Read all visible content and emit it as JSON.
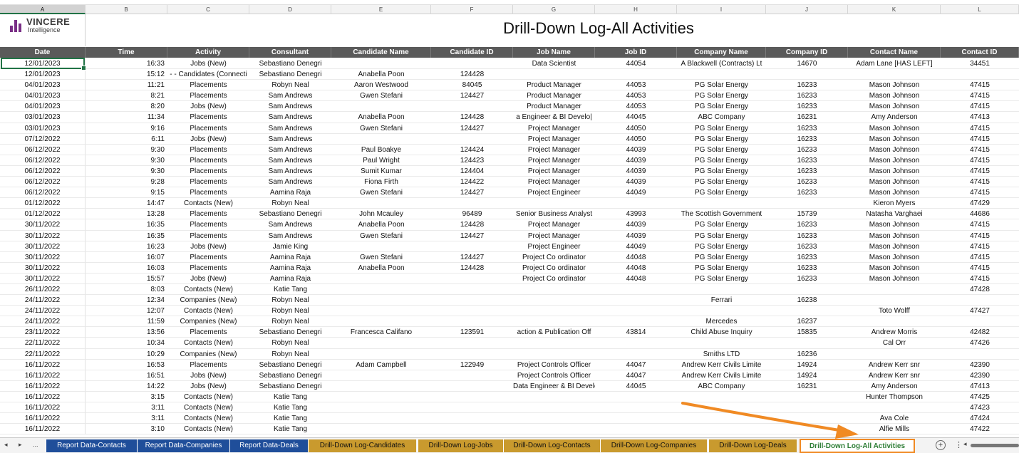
{
  "title": "Drill-Down Log-All Activities",
  "logo": {
    "name": "VINCERE",
    "sub": "Intelligence"
  },
  "column_letters": [
    "A",
    "B",
    "C",
    "D",
    "E",
    "F",
    "G",
    "H",
    "I",
    "J",
    "K",
    "L"
  ],
  "headers": [
    "Date",
    "Time",
    "Activity",
    "Consultant",
    "Candidate Name",
    "Candidate ID",
    "Job Name",
    "Job ID",
    "Company Name",
    "Company ID",
    "Contact Name",
    "Contact ID"
  ],
  "rows": [
    [
      "12/01/2023",
      "16:33",
      "Jobs (New)",
      "Sebastiano Denegri",
      "",
      "",
      "Data Scientist",
      "44054",
      "A Blackwell (Contracts) Lt",
      "14670",
      "Adam Lane [HAS LEFT]",
      "34451"
    ],
    [
      "12/01/2023",
      "15:12",
      "- - Candidates (Connecti",
      "Sebastiano Denegri",
      "Anabella Poon",
      "124428",
      "",
      "",
      "",
      "",
      "",
      ""
    ],
    [
      "04/01/2023",
      "11:21",
      "Placements",
      "Robyn Neal",
      "Aaron Westwood",
      "84045",
      "Product Manager",
      "44053",
      "PG Solar Energy",
      "16233",
      "Mason Johnson",
      "47415"
    ],
    [
      "04/01/2023",
      "8:21",
      "Placements",
      "Sam Andrews",
      "Gwen Stefani",
      "124427",
      "Product Manager",
      "44053",
      "PG Solar Energy",
      "16233",
      "Mason Johnson",
      "47415"
    ],
    [
      "04/01/2023",
      "8:20",
      "Jobs (New)",
      "Sam Andrews",
      "",
      "",
      "Product Manager",
      "44053",
      "PG Solar Energy",
      "16233",
      "Mason Johnson",
      "47415"
    ],
    [
      "03/01/2023",
      "11:34",
      "Placements",
      "Sam Andrews",
      "Anabella Poon",
      "124428",
      "a Engineer & BI Develo|",
      "44045",
      "ABC Company",
      "16231",
      "Amy Anderson",
      "47413"
    ],
    [
      "03/01/2023",
      "9:16",
      "Placements",
      "Sam Andrews",
      "Gwen Stefani",
      "124427",
      "Project Manager",
      "44050",
      "PG Solar Energy",
      "16233",
      "Mason Johnson",
      "47415"
    ],
    [
      "07/12/2022",
      "6:11",
      "Jobs (New)",
      "Sam Andrews",
      "",
      "",
      "Project Manager",
      "44050",
      "PG Solar Energy",
      "16233",
      "Mason Johnson",
      "47415"
    ],
    [
      "06/12/2022",
      "9:30",
      "Placements",
      "Sam Andrews",
      "Paul Boakye",
      "124424",
      "Project Manager",
      "44039",
      "PG Solar Energy",
      "16233",
      "Mason Johnson",
      "47415"
    ],
    [
      "06/12/2022",
      "9:30",
      "Placements",
      "Sam Andrews",
      "Paul Wright",
      "124423",
      "Project Manager",
      "44039",
      "PG Solar Energy",
      "16233",
      "Mason Johnson",
      "47415"
    ],
    [
      "06/12/2022",
      "9:30",
      "Placements",
      "Sam Andrews",
      "Sumit Kumar",
      "124404",
      "Project Manager",
      "44039",
      "PG Solar Energy",
      "16233",
      "Mason Johnson",
      "47415"
    ],
    [
      "06/12/2022",
      "9:28",
      "Placements",
      "Sam Andrews",
      "Fiona Firth",
      "124422",
      "Project Manager",
      "44039",
      "PG Solar Energy",
      "16233",
      "Mason Johnson",
      "47415"
    ],
    [
      "06/12/2022",
      "9:15",
      "Placements",
      "Aamina Raja",
      "Gwen Stefani",
      "124427",
      "Project Engineer",
      "44049",
      "PG Solar Energy",
      "16233",
      "Mason Johnson",
      "47415"
    ],
    [
      "01/12/2022",
      "14:47",
      "Contacts (New)",
      "Robyn Neal",
      "",
      "",
      "",
      "",
      "",
      "",
      "Kieron Myers",
      "47429"
    ],
    [
      "01/12/2022",
      "13:28",
      "Placements",
      "Sebastiano Denegri",
      "John Mcauley",
      "96489",
      "Senior Business Analyst",
      "43993",
      "The Scottish Government",
      "15739",
      "Natasha Varghaei",
      "44686"
    ],
    [
      "30/11/2022",
      "16:35",
      "Placements",
      "Sam Andrews",
      "Anabella Poon",
      "124428",
      "Project Manager",
      "44039",
      "PG Solar Energy",
      "16233",
      "Mason Johnson",
      "47415"
    ],
    [
      "30/11/2022",
      "16:35",
      "Placements",
      "Sam Andrews",
      "Gwen Stefani",
      "124427",
      "Project Manager",
      "44039",
      "PG Solar Energy",
      "16233",
      "Mason Johnson",
      "47415"
    ],
    [
      "30/11/2022",
      "16:23",
      "Jobs (New)",
      "Jamie King",
      "",
      "",
      "Project Engineer",
      "44049",
      "PG Solar Energy",
      "16233",
      "Mason Johnson",
      "47415"
    ],
    [
      "30/11/2022",
      "16:07",
      "Placements",
      "Aamina Raja",
      "Gwen Stefani",
      "124427",
      "Project Co ordinator",
      "44048",
      "PG Solar Energy",
      "16233",
      "Mason Johnson",
      "47415"
    ],
    [
      "30/11/2022",
      "16:03",
      "Placements",
      "Aamina Raja",
      "Anabella Poon",
      "124428",
      "Project Co ordinator",
      "44048",
      "PG Solar Energy",
      "16233",
      "Mason Johnson",
      "47415"
    ],
    [
      "30/11/2022",
      "15:57",
      "Jobs (New)",
      "Aamina Raja",
      "",
      "",
      "Project Co ordinator",
      "44048",
      "PG Solar Energy",
      "16233",
      "Mason Johnson",
      "47415"
    ],
    [
      "26/11/2022",
      "8:03",
      "Contacts (New)",
      "Katie Tang",
      "",
      "",
      "",
      "",
      "",
      "",
      "",
      "47428"
    ],
    [
      "24/11/2022",
      "12:34",
      "Companies (New)",
      "Robyn Neal",
      "",
      "",
      "",
      "",
      "Ferrari",
      "16238",
      "",
      ""
    ],
    [
      "24/11/2022",
      "12:07",
      "Contacts (New)",
      "Robyn Neal",
      "",
      "",
      "",
      "",
      "",
      "",
      "Toto Wolff",
      "47427"
    ],
    [
      "24/11/2022",
      "11:59",
      "Companies (New)",
      "Robyn Neal",
      "",
      "",
      "",
      "",
      "Mercedes",
      "16237",
      "",
      ""
    ],
    [
      "23/11/2022",
      "13:56",
      "Placements",
      "Sebastiano Denegri",
      "Francesca Califano",
      "123591",
      "action & Publication Off",
      "43814",
      "Child Abuse Inquiry",
      "15835",
      "Andrew Morris",
      "42482"
    ],
    [
      "22/11/2022",
      "10:34",
      "Contacts (New)",
      "Robyn Neal",
      "",
      "",
      "",
      "",
      "",
      "",
      "Cal Orr",
      "47426"
    ],
    [
      "22/11/2022",
      "10:29",
      "Companies (New)",
      "Robyn Neal",
      "",
      "",
      "",
      "",
      "Smiths LTD",
      "16236",
      "",
      ""
    ],
    [
      "16/11/2022",
      "16:53",
      "Placements",
      "Sebastiano Denegri",
      "Adam Campbell",
      "122949",
      "Project Controls Officer",
      "44047",
      "Andrew Kerr Civils Limite",
      "14924",
      "Andrew Kerr snr",
      "42390"
    ],
    [
      "16/11/2022",
      "16:51",
      "Jobs (New)",
      "Sebastiano Denegri",
      "",
      "",
      "Project Controls Officer",
      "44047",
      "Andrew Kerr Civils Limite",
      "14924",
      "Andrew Kerr snr",
      "42390"
    ],
    [
      "16/11/2022",
      "14:22",
      "Jobs (New)",
      "Sebastiano Denegri",
      "",
      "",
      "Data Engineer & BI Develo|",
      "44045",
      "ABC Company",
      "16231",
      "Amy Anderson",
      "47413"
    ],
    [
      "16/11/2022",
      "3:15",
      "Contacts (New)",
      "Katie Tang",
      "",
      "",
      "",
      "",
      "",
      "",
      "Hunter Thompson",
      "47425"
    ],
    [
      "16/11/2022",
      "3:11",
      "Contacts (New)",
      "Katie Tang",
      "",
      "",
      "",
      "",
      "",
      "",
      "",
      "47423"
    ],
    [
      "16/11/2022",
      "3:11",
      "Contacts (New)",
      "Katie Tang",
      "",
      "",
      "",
      "",
      "",
      "",
      "Ava Cole",
      "47424"
    ],
    [
      "16/11/2022",
      "3:10",
      "Contacts (New)",
      "Katie Tang",
      "",
      "",
      "",
      "",
      "",
      "",
      "Alfie Mills",
      "47422"
    ]
  ],
  "tabs": [
    {
      "label": "Report Data-Contacts",
      "style": "blue"
    },
    {
      "label": "Report Data-Companies",
      "style": "blue"
    },
    {
      "label": "Report Data-Deals",
      "style": "blue"
    },
    {
      "label": "Drill-Down Log-Candidates",
      "style": "gold"
    },
    {
      "label": "Drill-Down Log-Jobs",
      "style": "gold"
    },
    {
      "label": "Drill-Down Log-Contacts",
      "style": "gold"
    },
    {
      "label": "Drill-Down Log-Companies",
      "style": "gold"
    },
    {
      "label": "Drill-Down Log-Deals",
      "style": "gold"
    },
    {
      "label": "Drill-Down Log-All Activities",
      "style": "active"
    }
  ],
  "nav": {
    "prev": "◂",
    "next": "▸",
    "ellipsis": "..."
  },
  "add_sheet": "+",
  "more_menu": "⋮",
  "colors": {
    "header_bg": "#5a5a5a",
    "tab_blue": "#1f4e9a",
    "tab_gold": "#c99a2e",
    "arrow": "#f08a24",
    "brand": "#7a2f86",
    "selection": "#217346"
  }
}
